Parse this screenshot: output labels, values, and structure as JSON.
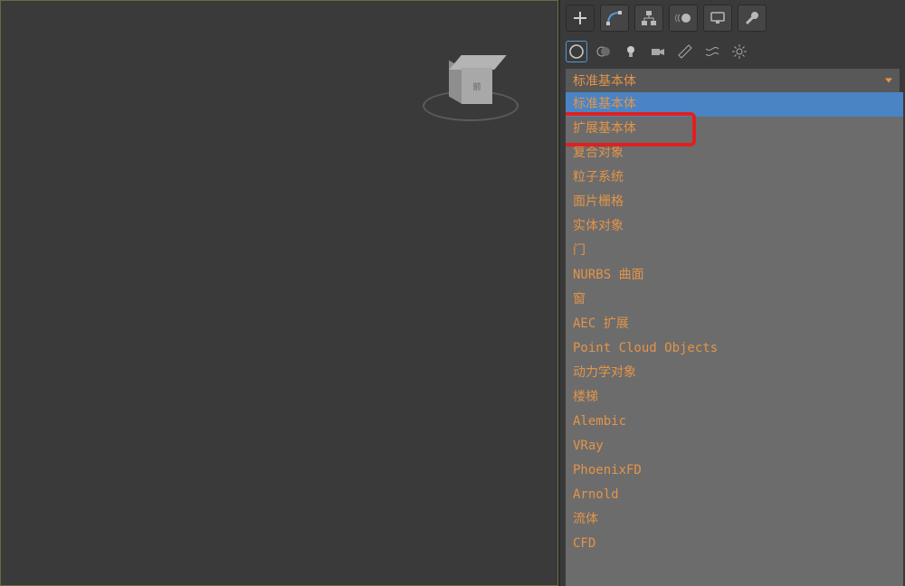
{
  "tabs_main": [
    {
      "name": "create",
      "active": true
    },
    {
      "name": "modify",
      "active": false
    },
    {
      "name": "hierarchy",
      "active": false
    },
    {
      "name": "motion",
      "active": false
    },
    {
      "name": "display",
      "active": false
    },
    {
      "name": "utilities",
      "active": false
    }
  ],
  "tabs_sub": [
    {
      "name": "geometry",
      "active": true
    },
    {
      "name": "shapes",
      "active": false
    },
    {
      "name": "lights",
      "active": false
    },
    {
      "name": "cameras",
      "active": false
    },
    {
      "name": "helpers",
      "active": false
    },
    {
      "name": "spacewarp",
      "active": false
    },
    {
      "name": "systems",
      "active": false
    }
  ],
  "dropdown": {
    "current": "标准基本体",
    "items": [
      {
        "label": "标准基本体",
        "selected": true
      },
      {
        "label": "扩展基本体",
        "selected": false,
        "highlighted": true
      },
      {
        "label": "复合对象",
        "selected": false
      },
      {
        "label": "粒子系统",
        "selected": false
      },
      {
        "label": "面片栅格",
        "selected": false
      },
      {
        "label": "实体对象",
        "selected": false
      },
      {
        "label": "门",
        "selected": false
      },
      {
        "label": "NURBS 曲面",
        "selected": false
      },
      {
        "label": "窗",
        "selected": false
      },
      {
        "label": "AEC 扩展",
        "selected": false
      },
      {
        "label": "Point Cloud Objects",
        "selected": false
      },
      {
        "label": "动力学对象",
        "selected": false
      },
      {
        "label": "楼梯",
        "selected": false
      },
      {
        "label": "Alembic",
        "selected": false
      },
      {
        "label": "VRay",
        "selected": false
      },
      {
        "label": "PhoenixFD",
        "selected": false
      },
      {
        "label": "Arnold",
        "selected": false
      },
      {
        "label": "流体",
        "selected": false
      },
      {
        "label": "CFD",
        "selected": false
      }
    ]
  },
  "viewport": {
    "navcube_label": "前"
  }
}
